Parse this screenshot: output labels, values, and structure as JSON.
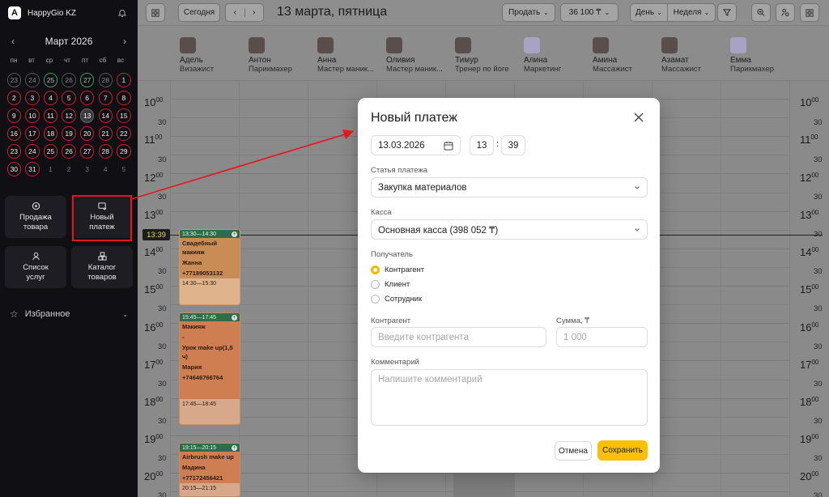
{
  "brand": {
    "name": "HappyGio KZ",
    "logo_letter": "A"
  },
  "calendar": {
    "month_title": "Март 2026",
    "weekdays": [
      "пн",
      "вт",
      "ср",
      "чт",
      "пт",
      "сб",
      "вс"
    ],
    "weeks": [
      [
        "23",
        "24",
        "25",
        "26",
        "27",
        "28",
        "1"
      ],
      [
        "2",
        "3",
        "4",
        "5",
        "6",
        "7",
        "8"
      ],
      [
        "9",
        "10",
        "11",
        "12",
        "13",
        "14",
        "15"
      ],
      [
        "16",
        "17",
        "18",
        "19",
        "20",
        "21",
        "22"
      ],
      [
        "23",
        "24",
        "25",
        "26",
        "27",
        "28",
        "29"
      ],
      [
        "30",
        "31",
        "1",
        "2",
        "3",
        "4",
        "5"
      ]
    ],
    "colors": {
      "red": "#c8202a",
      "green": "#3f9a52"
    }
  },
  "quick_actions": [
    {
      "label_1": "Продажа",
      "label_2": "товара",
      "icon": "sale-icon"
    },
    {
      "label_1": "Новый",
      "label_2": "платеж",
      "icon": "new-payment-icon"
    },
    {
      "label_1": "Список",
      "label_2": "услуг",
      "icon": "services-icon"
    },
    {
      "label_1": "Каталог",
      "label_2": "товаров",
      "icon": "catalog-icon"
    }
  ],
  "favorites_label": "Избранное",
  "topbar": {
    "today": "Сегодня",
    "date_title": "13 марта, пятница",
    "sell": "Продать",
    "amount": "36 100 ₸",
    "view_day": "День",
    "view_week": "Неделя"
  },
  "staff": [
    {
      "name": "Адель",
      "role": "Визажист"
    },
    {
      "name": "Антон",
      "role": "Парикмахер"
    },
    {
      "name": "Анна",
      "role": "Мастер маник..."
    },
    {
      "name": "Оливия",
      "role": "Мастер маник..."
    },
    {
      "name": "Тимур",
      "role": "Тренер по йоге"
    },
    {
      "name": "Алина",
      "role": "Маркетинг"
    },
    {
      "name": "Амина",
      "role": "Массажист"
    },
    {
      "name": "Азамат",
      "role": "Массажист"
    },
    {
      "name": "Емма",
      "role": "Парикмахер"
    }
  ],
  "schedule": {
    "hours": [
      "10",
      "11",
      "12",
      "13",
      "14",
      "15",
      "16",
      "17",
      "18",
      "19",
      "20"
    ],
    "minutes_label": "00",
    "half_label": "30",
    "now_time": "13:39"
  },
  "bookings": [
    {
      "time": "13:30—14:30",
      "lines": [
        "Свадебный макияж",
        "Жанна",
        "+77189053132"
      ],
      "extra": "14:30—15:30"
    },
    {
      "time": "15:45—17:45",
      "lines": [
        "Макияж",
        "-",
        "Урок make up(1,5 ч)",
        "Мария",
        "+74646766764"
      ],
      "extra": "17:45—18:45"
    },
    {
      "time": "19:15—20:15",
      "lines": [
        "Airbrush make up",
        "Мадина",
        "+77172456421"
      ],
      "extra": "20:15—21:15"
    }
  ],
  "modal": {
    "title": "Новый платеж",
    "date": "13.03.2026",
    "hour": "13",
    "minute": "39",
    "time_sep": ":",
    "article_label": "Статья платежа",
    "article_value": "Закупка материалов",
    "cashbox_label": "Касса",
    "cashbox_value": "Основная касса (398 052 ₸)",
    "recipient_label": "Получатель",
    "recipients": [
      "Контрагент",
      "Клиент",
      "Сотрудник"
    ],
    "counterparty_label": "Контрагент",
    "counterparty_placeholder": "Введите контрагента",
    "sum_label": "Сумма, ₸",
    "sum_placeholder": "1 000",
    "comment_label": "Комментарий",
    "comment_placeholder": "Напишите комментарий",
    "cancel": "Отмена",
    "save": "Сохранить",
    "accent": "#f8c009"
  }
}
